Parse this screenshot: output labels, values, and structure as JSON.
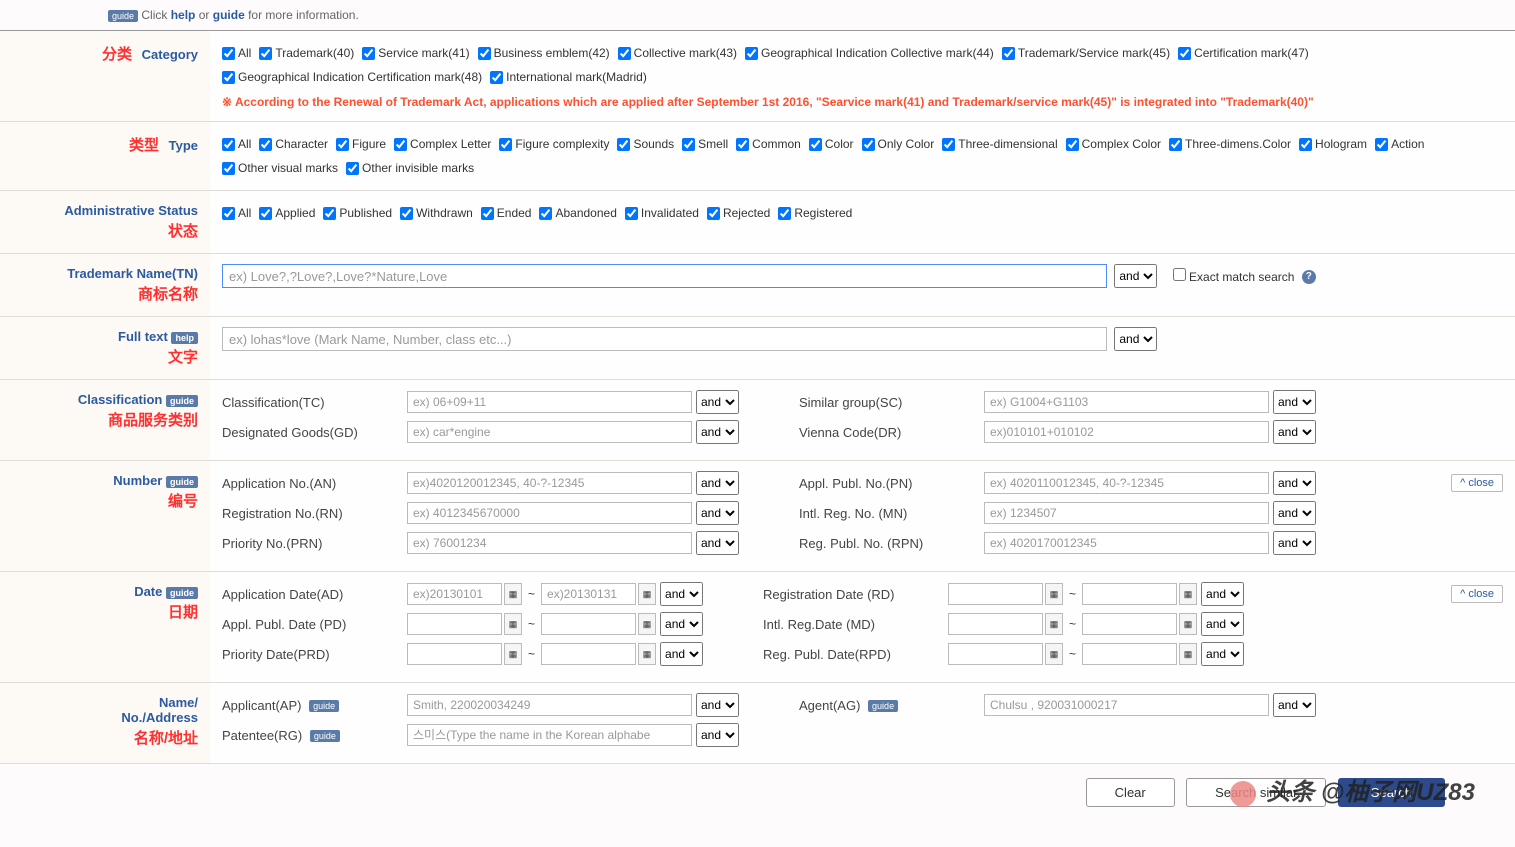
{
  "top": {
    "guide_badge": "guide",
    "text_prefix": "Click",
    "help_link": "help",
    "text_or": "or",
    "guide_link": "guide",
    "text_suffix": "for more information."
  },
  "rows": {
    "category": {
      "cn": "分类",
      "en": "Category",
      "items": [
        "All",
        "Trademark(40)",
        "Service mark(41)",
        "Business emblem(42)",
        "Collective mark(43)",
        "Geographical Indication Collective mark(44)",
        "Trademark/Service mark(45)",
        "Certification mark(47)",
        "Geographical Indication Certification mark(48)",
        "International mark(Madrid)"
      ],
      "note": "※ According to the Renewal of Trademark Act, applications which are applied after September 1st 2016, \"Searvice mark(41) and Trademark/service mark(45)\" is integrated into \"Trademark(40)\""
    },
    "type": {
      "cn": "类型",
      "en": "Type",
      "items": [
        "All",
        "Character",
        "Figure",
        "Complex Letter",
        "Figure complexity",
        "Sounds",
        "Smell",
        "Common",
        "Color",
        "Only Color",
        "Three-dimensional",
        "Complex Color",
        "Three-dimens.Color",
        "Hologram",
        "Action",
        "Other visual marks",
        "Other invisible marks"
      ]
    },
    "admin_status": {
      "en": "Administrative Status",
      "cn": "状态",
      "items": [
        "All",
        "Applied",
        "Published",
        "Withdrawn",
        "Ended",
        "Abandoned",
        "Invalidated",
        "Rejected",
        "Registered"
      ]
    },
    "trademark_name": {
      "en": "Trademark Name(TN)",
      "cn": "商标名称",
      "placeholder": "ex) Love?,?Love?,Love?*Nature,Love",
      "op": "and",
      "exact_label": "Exact match search"
    },
    "full_text": {
      "en": "Full text",
      "cn": "文字",
      "help": "help",
      "placeholder": "ex) lohas*love (Mark Name, Number, class etc...)",
      "op": "and"
    },
    "classification": {
      "en": "Classification",
      "cn": "商品服务类别",
      "guide": "guide",
      "fields": [
        {
          "label": "Classification(TC)",
          "ph": "ex) 06+09+11",
          "op": "and"
        },
        {
          "label": "Designated Goods(GD)",
          "ph": "ex) car*engine",
          "op": "and"
        }
      ],
      "right_fields": [
        {
          "label": "Similar group(SC)",
          "ph": "ex) G1004+G1103",
          "op": "and"
        },
        {
          "label": "Vienna Code(DR)",
          "ph": "ex)010101+010102",
          "op": "and"
        }
      ]
    },
    "number": {
      "en": "Number",
      "cn": "编号",
      "guide": "guide",
      "close": "close",
      "left": [
        {
          "label": "Application No.(AN)",
          "ph": "ex)4020120012345, 40-?-12345",
          "op": "and"
        },
        {
          "label": "Registration No.(RN)",
          "ph": "ex) 4012345670000",
          "op": "and"
        },
        {
          "label": "Priority No.(PRN)",
          "ph": "ex) 76001234",
          "op": "and"
        }
      ],
      "right": [
        {
          "label": "Appl. Publ. No.(PN)",
          "ph": "ex) 4020110012345, 40-?-12345",
          "op": "and"
        },
        {
          "label": "Intl. Reg. No. (MN)",
          "ph": "ex) 1234507",
          "op": "and"
        },
        {
          "label": "Reg. Publ. No. (RPN)",
          "ph": "ex) 4020170012345",
          "op": "and"
        }
      ]
    },
    "date": {
      "en": "Date",
      "cn": "日期",
      "guide": "guide",
      "close": "close",
      "left": [
        {
          "label": "Application Date(AD)",
          "ph1": "ex)20130101",
          "ph2": "ex)20130131",
          "op": "and"
        },
        {
          "label": "Appl. Publ. Date (PD)",
          "ph1": "",
          "ph2": "",
          "op": "and"
        },
        {
          "label": "Priority Date(PRD)",
          "ph1": "",
          "ph2": "",
          "op": "and"
        }
      ],
      "right": [
        {
          "label": "Registration Date (RD)",
          "ph1": "",
          "ph2": "",
          "op": "and"
        },
        {
          "label": "Intl. Reg.Date (MD)",
          "ph1": "",
          "ph2": "",
          "op": "and"
        },
        {
          "label": "Reg. Publ. Date(RPD)",
          "ph1": "",
          "ph2": "",
          "op": "and"
        }
      ]
    },
    "name_address": {
      "en1": "Name/",
      "en2": "No./Address",
      "cn": "名称/地址",
      "guide": "guide",
      "left": [
        {
          "label": "Applicant(AP)",
          "ph": "Smith, 220020034249",
          "op": "and",
          "has_guide": true
        },
        {
          "label": "Patentee(RG)",
          "ph": "스미스(Type the name in the Korean alphabe",
          "op": "and",
          "has_guide": true
        }
      ],
      "right": [
        {
          "label": "Agent(AG)",
          "ph": "Chulsu , 920031000217",
          "op": "and",
          "has_guide": true
        }
      ]
    }
  },
  "buttons": {
    "clear": "Clear",
    "search_similar": "Search similar",
    "search": "Search"
  },
  "watermark": "头条 @柚子网UZ83"
}
